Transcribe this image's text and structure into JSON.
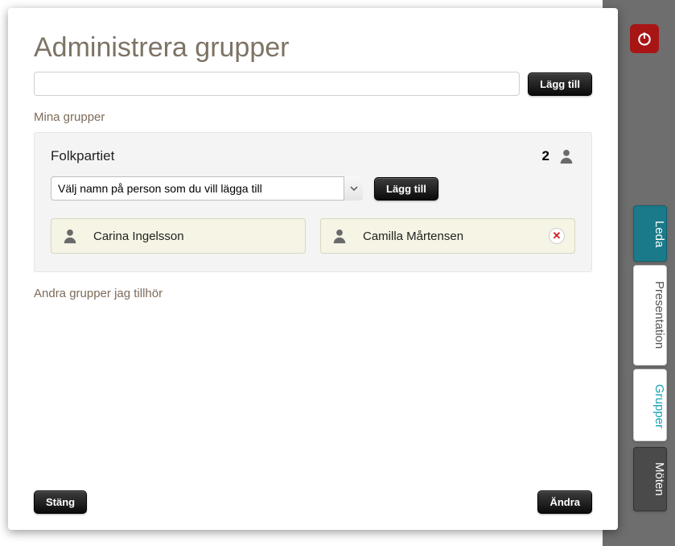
{
  "modal": {
    "title": "Administrera grupper",
    "new_group_placeholder": "",
    "add_group_btn": "Lägg till",
    "my_groups_label": "Mina grupper",
    "other_groups_label": "Andra grupper jag tillhör",
    "close_btn": "Stäng",
    "change_btn": "Ändra"
  },
  "group": {
    "name": "Folkpartiet",
    "count": "2",
    "select_placeholder": "Välj namn på person som du vill lägga till",
    "add_person_btn": "Lägg till",
    "members": [
      {
        "name": "Carina Ingelsson",
        "removable": false
      },
      {
        "name": "Camilla Mårtensen",
        "removable": true
      }
    ]
  },
  "sidebar": {
    "tabs": [
      {
        "label": "Leda"
      },
      {
        "label": "Presentation"
      },
      {
        "label": "Grupper"
      },
      {
        "label": "Möten"
      }
    ]
  }
}
